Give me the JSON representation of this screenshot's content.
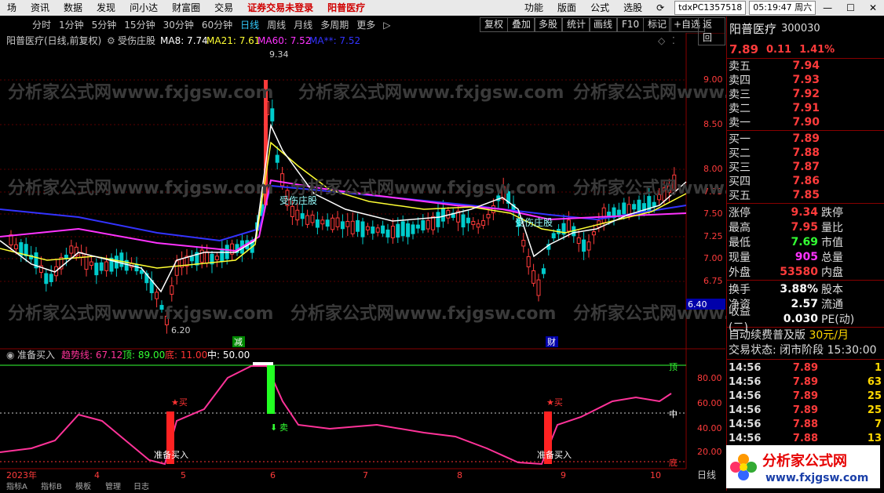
{
  "menubar": {
    "items": [
      "场",
      "资讯",
      "数据",
      "发现",
      "问小达",
      "财富圈",
      "交易"
    ],
    "warning": "证券交易未登录",
    "stock_name": "阳普医疗",
    "right_items": [
      "功能",
      "版面",
      "公式",
      "选股"
    ],
    "user": "tdxPC1357518",
    "clock": "05:19:47 周六"
  },
  "period_bar": {
    "items": [
      "分时",
      "1分钟",
      "5分钟",
      "15分钟",
      "30分钟",
      "60分钟",
      "日线",
      "周线",
      "月线",
      "多周期",
      "更多"
    ],
    "active": "日线",
    "right_buttons": [
      "复权",
      "叠加",
      "多股",
      "统计",
      "画线",
      "F10",
      "标记",
      "+自选",
      "返回"
    ]
  },
  "main_chart": {
    "title": "阳普医疗(日线,前复权)",
    "indicator": "受伤庄股",
    "ma_labels": [
      {
        "text": "MA8: 7.74",
        "color": "#ffffff"
      },
      {
        "text": "MA21: 7.61",
        "color": "#ffff33"
      },
      {
        "text": "MA60: 7.52",
        "color": "#ff33ff"
      },
      {
        "text": "MA**: 7.52",
        "color": "#3333ff"
      }
    ],
    "y_ticks": [
      "9.00",
      "8.50",
      "8.00",
      "7.75",
      "7.50",
      "7.25",
      "7.00",
      "6.75",
      "6.40"
    ],
    "high_label": "9.34",
    "low_label": "6.20",
    "signal_text_1": "受伤庄股",
    "signal_text_2": "受伤庄股",
    "marker_1": "减",
    "marker_2": "财",
    "watermark": "分析家公式网www.fxjgsw.com"
  },
  "sub_chart": {
    "name": "准备买入",
    "values": [
      {
        "text": "趋势线: 67.12",
        "color": "#ff3399"
      },
      {
        "text": "顶: 89.00",
        "color": "#33ff33"
      },
      {
        "text": "底: 11.00",
        "color": "#ff3333"
      },
      {
        "text": "中: 50.00",
        "color": "#ffffff"
      }
    ],
    "y_ticks": [
      "80.00",
      "60.00",
      "40.00",
      "20.00"
    ],
    "side_labels": [
      "顶",
      "中",
      "底"
    ],
    "buy_star": "★买",
    "sell_label": "卖",
    "prep_label": "准备买入"
  },
  "date_axis": {
    "labels": [
      "2023年",
      "4",
      "5",
      "6",
      "7",
      "8",
      "9",
      "10"
    ],
    "corner": "日线",
    "bottom_tabs": [
      "指标A",
      "指标B",
      "模板",
      "管理",
      "日志"
    ]
  },
  "quote_panel": {
    "name": "阳普医疗",
    "code": "300030",
    "price": "7.89",
    "change": "0.11",
    "pct": "1.41%",
    "asks": [
      {
        "label": "卖五",
        "price": "7.94",
        "vol": ""
      },
      {
        "label": "卖四",
        "price": "7.93",
        "vol": ""
      },
      {
        "label": "卖三",
        "price": "7.92",
        "vol": ""
      },
      {
        "label": "卖二",
        "price": "7.91",
        "vol": ""
      },
      {
        "label": "卖一",
        "price": "7.90",
        "vol": ""
      }
    ],
    "bids": [
      {
        "label": "买一",
        "price": "7.89",
        "vol": ""
      },
      {
        "label": "买二",
        "price": "7.88",
        "vol": ""
      },
      {
        "label": "买三",
        "price": "7.87",
        "vol": ""
      },
      {
        "label": "买四",
        "price": "7.86",
        "vol": ""
      },
      {
        "label": "买五",
        "price": "7.85",
        "vol": ""
      }
    ],
    "stats": [
      {
        "l": "涨停",
        "v": "9.34",
        "c": "#ff3b3b",
        "l2": "跌停"
      },
      {
        "l": "最高",
        "v": "7.95",
        "c": "#ff3b3b",
        "l2": "量比"
      },
      {
        "l": "最低",
        "v": "7.69",
        "c": "#33ff33",
        "l2": "市值"
      },
      {
        "l": "现量",
        "v": "905",
        "c": "#ff33ff",
        "l2": "总量"
      },
      {
        "l": "外盘",
        "v": "53580",
        "c": "#ff3b3b",
        "l2": "内盘"
      }
    ],
    "stats2": [
      {
        "l": "换手",
        "v": "3.88%",
        "c": "#ffffff",
        "l2": "股本"
      },
      {
        "l": "净资",
        "v": "2.57",
        "c": "#ffffff",
        "l2": "流通"
      },
      {
        "l": "收益(二)",
        "v": "0.030",
        "c": "#ffffff",
        "l2": "PE(动)"
      }
    ],
    "notice": "自动续费普及版",
    "notice_price": "30元/月",
    "trade_state": "交易状态: 闭市阶段",
    "trade_time": "15:30:00",
    "ticks": [
      {
        "t": "14:56",
        "p": "7.89",
        "q": "1"
      },
      {
        "t": "14:56",
        "p": "7.89",
        "q": "63"
      },
      {
        "t": "14:56",
        "p": "7.89",
        "q": "25"
      },
      {
        "t": "14:56",
        "p": "7.89",
        "q": "25"
      },
      {
        "t": "14:56",
        "p": "7.88",
        "q": "7"
      },
      {
        "t": "14:56",
        "p": "7.88",
        "q": "13"
      }
    ],
    "logo_text": "分析家公式网",
    "logo_url": "www.fxjgsw.com"
  },
  "colors": {
    "up": "#ff3b3b",
    "down": "#00cccc",
    "ma8": "#ffffff",
    "ma21": "#ffff33",
    "ma60": "#ff33ff",
    "ma_long": "#3333ff",
    "trend": "#ff3399"
  }
}
